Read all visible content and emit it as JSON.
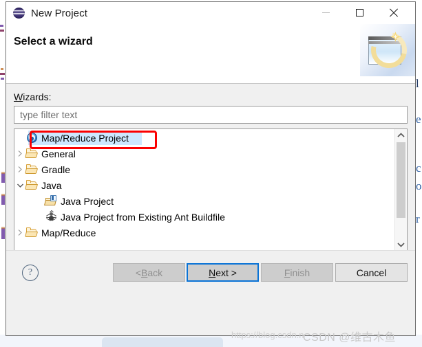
{
  "window": {
    "title": "New Project",
    "app_icon": "eclipse-sphere-icon",
    "controls": {
      "minimize": "minimize-icon",
      "maximize": "maximize-icon",
      "close": "close-icon"
    }
  },
  "header": {
    "title": "Select a wizard",
    "banner_icon": "wizard-banner-image"
  },
  "body": {
    "wizards_label_mnemonic": "W",
    "wizards_label_rest": "izards:",
    "filter": {
      "placeholder": "type filter text",
      "value": ""
    },
    "tree": [
      {
        "label": "Map/Reduce Project",
        "icon": "map-reduce-project-icon",
        "indent": 0,
        "arrow": "none",
        "selected": true,
        "highlighted": true
      },
      {
        "label": "General",
        "icon": "folder-icon",
        "indent": 0,
        "arrow": "collapsed",
        "selected": false,
        "highlighted": false
      },
      {
        "label": "Gradle",
        "icon": "folder-icon",
        "indent": 0,
        "arrow": "collapsed",
        "selected": false,
        "highlighted": false
      },
      {
        "label": "Java",
        "icon": "folder-icon",
        "indent": 0,
        "arrow": "expanded",
        "selected": false,
        "highlighted": false
      },
      {
        "label": "Java Project",
        "icon": "java-project-icon",
        "indent": 1,
        "arrow": "none",
        "selected": false,
        "highlighted": false
      },
      {
        "label": "Java Project from Existing Ant Buildfile",
        "icon": "ant-buildfile-icon",
        "indent": 1,
        "arrow": "none",
        "selected": false,
        "highlighted": false
      },
      {
        "label": "Map/Reduce",
        "icon": "folder-icon",
        "indent": 0,
        "arrow": "collapsed",
        "selected": false,
        "highlighted": false
      }
    ],
    "scrollbar": {
      "up_arrow": "chevron-up-icon",
      "down_arrow": "chevron-down-icon"
    }
  },
  "footer": {
    "help_icon": "help-question-icon",
    "buttons": [
      {
        "name": "back",
        "label": "< Back",
        "mnemonic": "B",
        "state": "disabled",
        "default": false
      },
      {
        "name": "next",
        "label": "Next >",
        "mnemonic": "N",
        "state": "enabled",
        "default": true
      },
      {
        "name": "finish",
        "label": "Finish",
        "mnemonic": "F",
        "state": "disabled",
        "default": false
      },
      {
        "name": "cancel",
        "label": "Cancel",
        "mnemonic": "",
        "state": "enabled",
        "default": false
      }
    ]
  },
  "annotation": {
    "type": "red-rectangle-highlight",
    "targets": "Map/Reduce Project",
    "color": "#fb0000"
  },
  "watermark": {
    "url": "https://blog.csdn.n",
    "brand": "CSDN @维古木鱼"
  },
  "background": {
    "right_edge_letters": [
      "l",
      "e",
      "c",
      "o",
      "r"
    ]
  },
  "colors": {
    "selection": "#cde8ff",
    "default_button_border": "#0a73d6",
    "annotation": "#fb0000",
    "dialog_face": "#f0f0f0"
  }
}
